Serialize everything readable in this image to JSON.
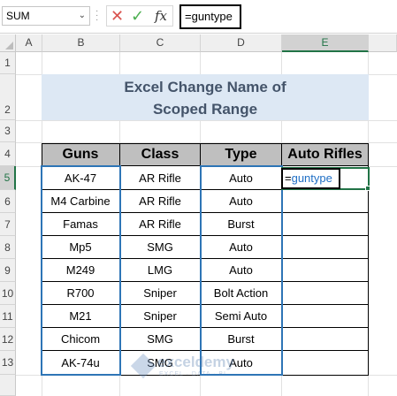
{
  "formula_bar": {
    "name_box": "SUM",
    "cancel_icon": "✕",
    "enter_icon": "✓",
    "fx_label": "fx",
    "formula": "=guntype"
  },
  "columns": [
    "A",
    "B",
    "C",
    "D",
    "E"
  ],
  "rows": [
    "1",
    "2",
    "3",
    "4",
    "5",
    "6",
    "7",
    "8",
    "9",
    "10",
    "11",
    "12",
    "13"
  ],
  "title": {
    "line1": "Excel Change Name of",
    "line2": "Scoped Range"
  },
  "table": {
    "headers": [
      "Guns",
      "Class",
      "Type",
      "Auto Rifles"
    ],
    "rows": [
      [
        "AK-47",
        "AR Rifle",
        "Auto"
      ],
      [
        "M4 Carbine",
        "AR Rifle",
        "Auto"
      ],
      [
        "Famas",
        "AR Rifle",
        "Burst"
      ],
      [
        "Mp5",
        "SMG",
        "Auto"
      ],
      [
        "M249",
        "LMG",
        "Auto"
      ],
      [
        "R700",
        "Sniper",
        "Bolt Action"
      ],
      [
        "M21",
        "Sniper",
        "Semi Auto"
      ],
      [
        "Chicom",
        "SMG",
        "Burst"
      ],
      [
        "AK-74u",
        "SMG",
        "Auto"
      ]
    ]
  },
  "active_cell": {
    "eq": "=",
    "ref": "guntype"
  },
  "watermark": {
    "name": "exceldemy",
    "tagline": "EXCEL · DATA · BI"
  },
  "colors": {
    "accent": "#217346",
    "range_highlight": "#2e75b6",
    "title_bg": "#dde8f4",
    "title_text": "#44546a",
    "header_bg": "#bfbfbf"
  }
}
